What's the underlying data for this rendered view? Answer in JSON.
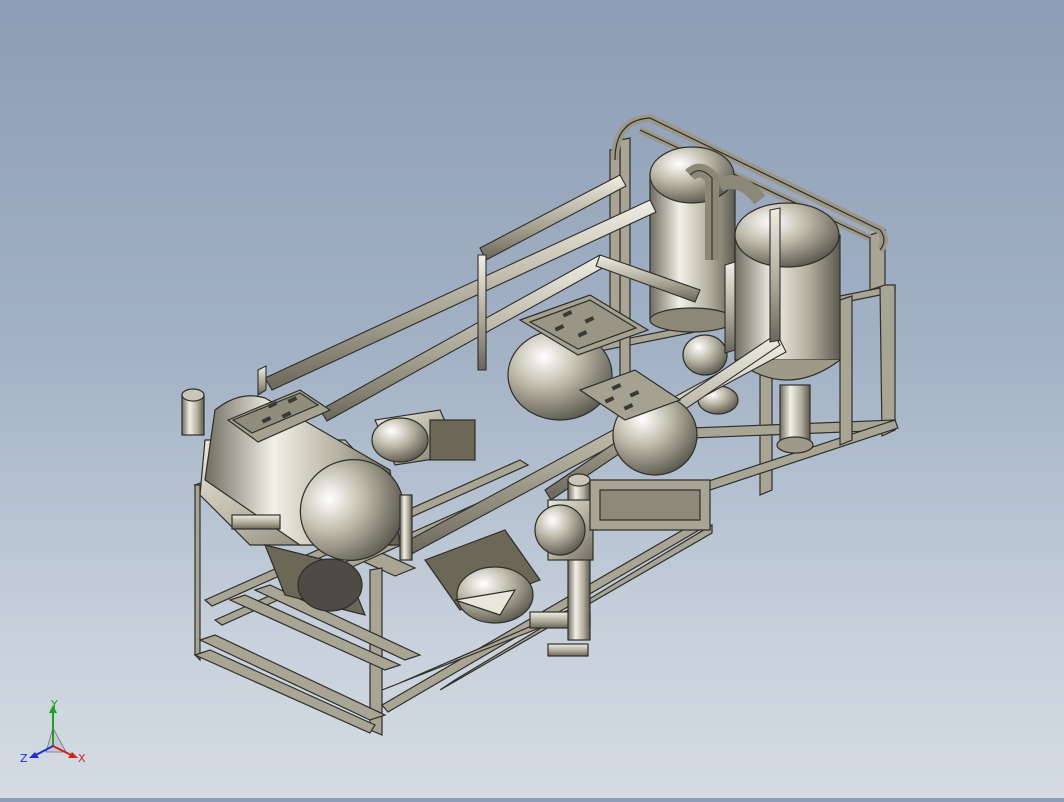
{
  "viewport": {
    "background_top": "#8d9db5",
    "background_bottom": "#d4dbe3",
    "model_color": "#b8b4a4",
    "model_edge_color": "#2e2e2a"
  },
  "triad": {
    "x_label": "X",
    "y_label": "Y",
    "z_label": "Z",
    "x_color": "#d42020",
    "y_color": "#20a020",
    "z_color": "#2030d0"
  }
}
